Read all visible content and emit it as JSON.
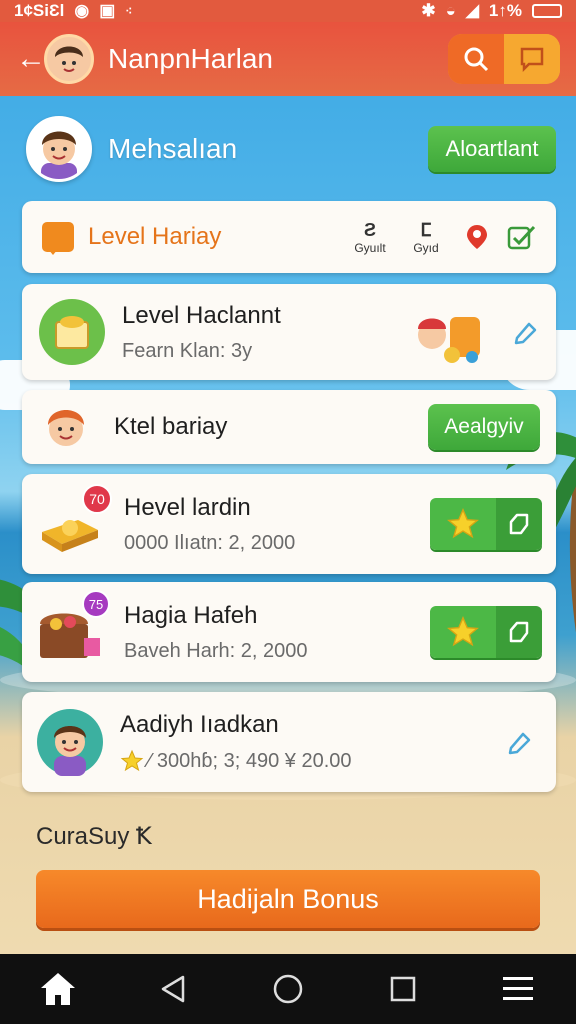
{
  "status": {
    "left_text": "1¢SiƐl",
    "right_text": "1↑%"
  },
  "appbar": {
    "title": "NanpnHarlan",
    "back_icon": "back-arrow-icon",
    "search_icon": "search-icon",
    "chat_icon": "chat-icon",
    "colors": {
      "bar": "#e8533e",
      "action_left": "#ef6a26",
      "action_right": "#f6a830"
    }
  },
  "profile": {
    "name": "Mehsalıan",
    "button_label": "Aloartlant"
  },
  "level_header": {
    "title": "Level Hariay",
    "mini1_glyph": "Ƨ",
    "mini1_label": "Gyuılt",
    "mini2_glyph": "ⵎ",
    "mini2_label": "Gyıd"
  },
  "rows": [
    {
      "title": "Level Haclannt",
      "sub": "Fearn Klan: 3y"
    },
    {
      "title": "Ktel bariay",
      "button_label": "Aealgyiv"
    },
    {
      "title": "Hevel lardin",
      "sub": "0000 Ilıatn: 2, 2000",
      "badge": "70"
    },
    {
      "title": "Hagia Hafeh",
      "sub": "Baveh Harh: 2, 2000",
      "badge": "75"
    },
    {
      "title": "Aadiyh Iıadkan",
      "sub": "⁄ 300hɓ; 3; 490 ¥ 20.00"
    }
  ],
  "bottom": {
    "label": "CuraSuy Ꝁ",
    "bonus_label": "Hadijaln Bonus"
  },
  "navbar": {
    "icons": [
      "home-icon",
      "back-triangle-icon",
      "home-circle-icon",
      "recent-square-icon",
      "menu-icon"
    ]
  }
}
